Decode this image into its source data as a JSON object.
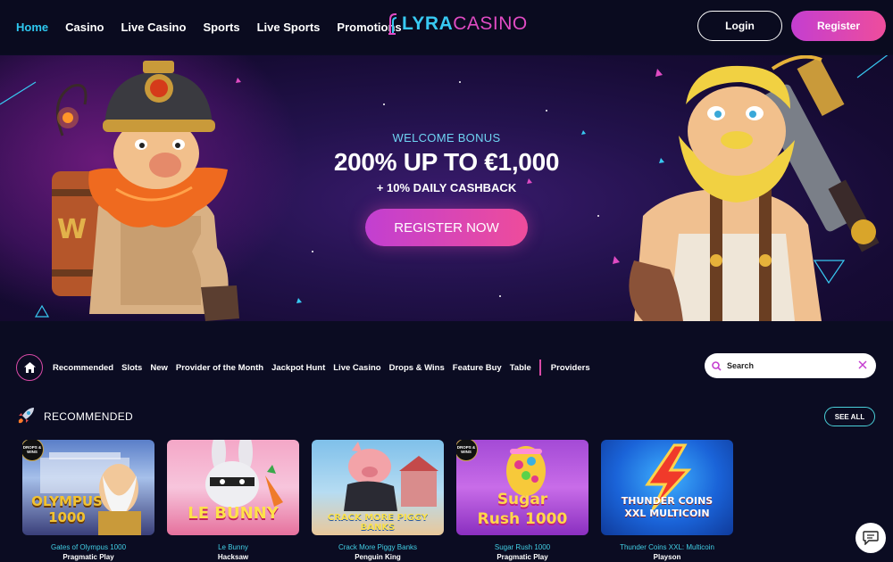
{
  "nav": {
    "items": [
      {
        "label": "Home",
        "active": true
      },
      {
        "label": "Casino"
      },
      {
        "label": "Live Casino"
      },
      {
        "label": "Sports"
      },
      {
        "label": "Live Sports"
      },
      {
        "label": "Promotions"
      }
    ]
  },
  "logo": {
    "part1": "LYRA",
    "part2": "CASINO"
  },
  "auth": {
    "login_label": "Login",
    "register_label": "Register"
  },
  "hero": {
    "eyebrow": "WELCOME BONUS",
    "headline": "200% UP TO €1,000",
    "subline": "+ 10% DAILY CASHBACK",
    "cta_label": "REGISTER NOW"
  },
  "filters": {
    "categories": [
      "Recommended",
      "Slots",
      "New",
      "Provider of the Month",
      "Jackpot Hunt",
      "Live Casino",
      "Drops & Wins",
      "Feature Buy",
      "Table"
    ],
    "providers_label": "Providers"
  },
  "search": {
    "placeholder": "Search"
  },
  "recommended": {
    "title": "RECOMMENDED",
    "see_all_label": "SEE ALL",
    "games": [
      {
        "title": "Gates of Olympus 1000",
        "provider": "Pragmatic Play",
        "thumb_text": "OLYMPUS 1000",
        "badge": "DROPS & WINS"
      },
      {
        "title": "Le Bunny",
        "provider": "Hacksaw",
        "thumb_text": "LE BUNNY"
      },
      {
        "title": "Crack More Piggy Banks",
        "provider": "Penguin King",
        "thumb_text": "CRACK MORE PIGGY BANKS"
      },
      {
        "title": "Sugar Rush 1000",
        "provider": "Pragmatic Play",
        "thumb_text": "Sugar Rush 1000",
        "badge": "DROPS & WINS"
      },
      {
        "title": "Thunder Coins XXL: Multicoin",
        "provider": "Playson",
        "thumb_text": "THUNDER COINS XXL MULTICOIN"
      }
    ]
  },
  "colors": {
    "accent_cyan": "#2ec8f0",
    "accent_pink": "#e04bc3",
    "background": "#0b0c22"
  }
}
